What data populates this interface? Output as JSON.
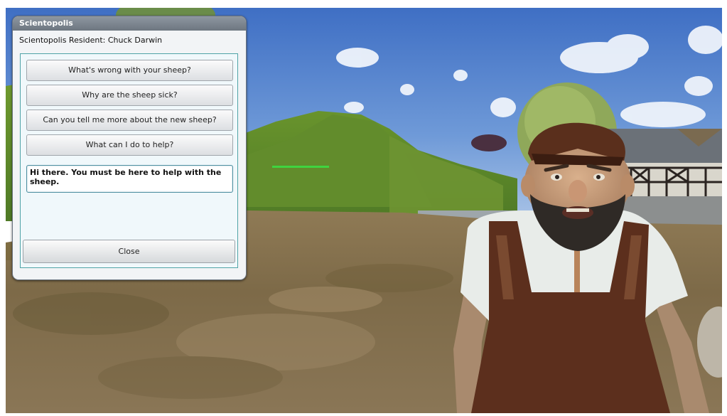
{
  "dialog": {
    "window_title": "Scientopolis",
    "speaker": "Scientopolis Resident: Chuck Darwin",
    "options": [
      "What's wrong with your sheep?",
      "Why are the sheep sick?",
      "Can you tell me more about the new sheep?",
      "What can I do to help?"
    ],
    "npc_speech": "Hi there. You must be here to help with the sheep.",
    "close_label": "Close"
  }
}
